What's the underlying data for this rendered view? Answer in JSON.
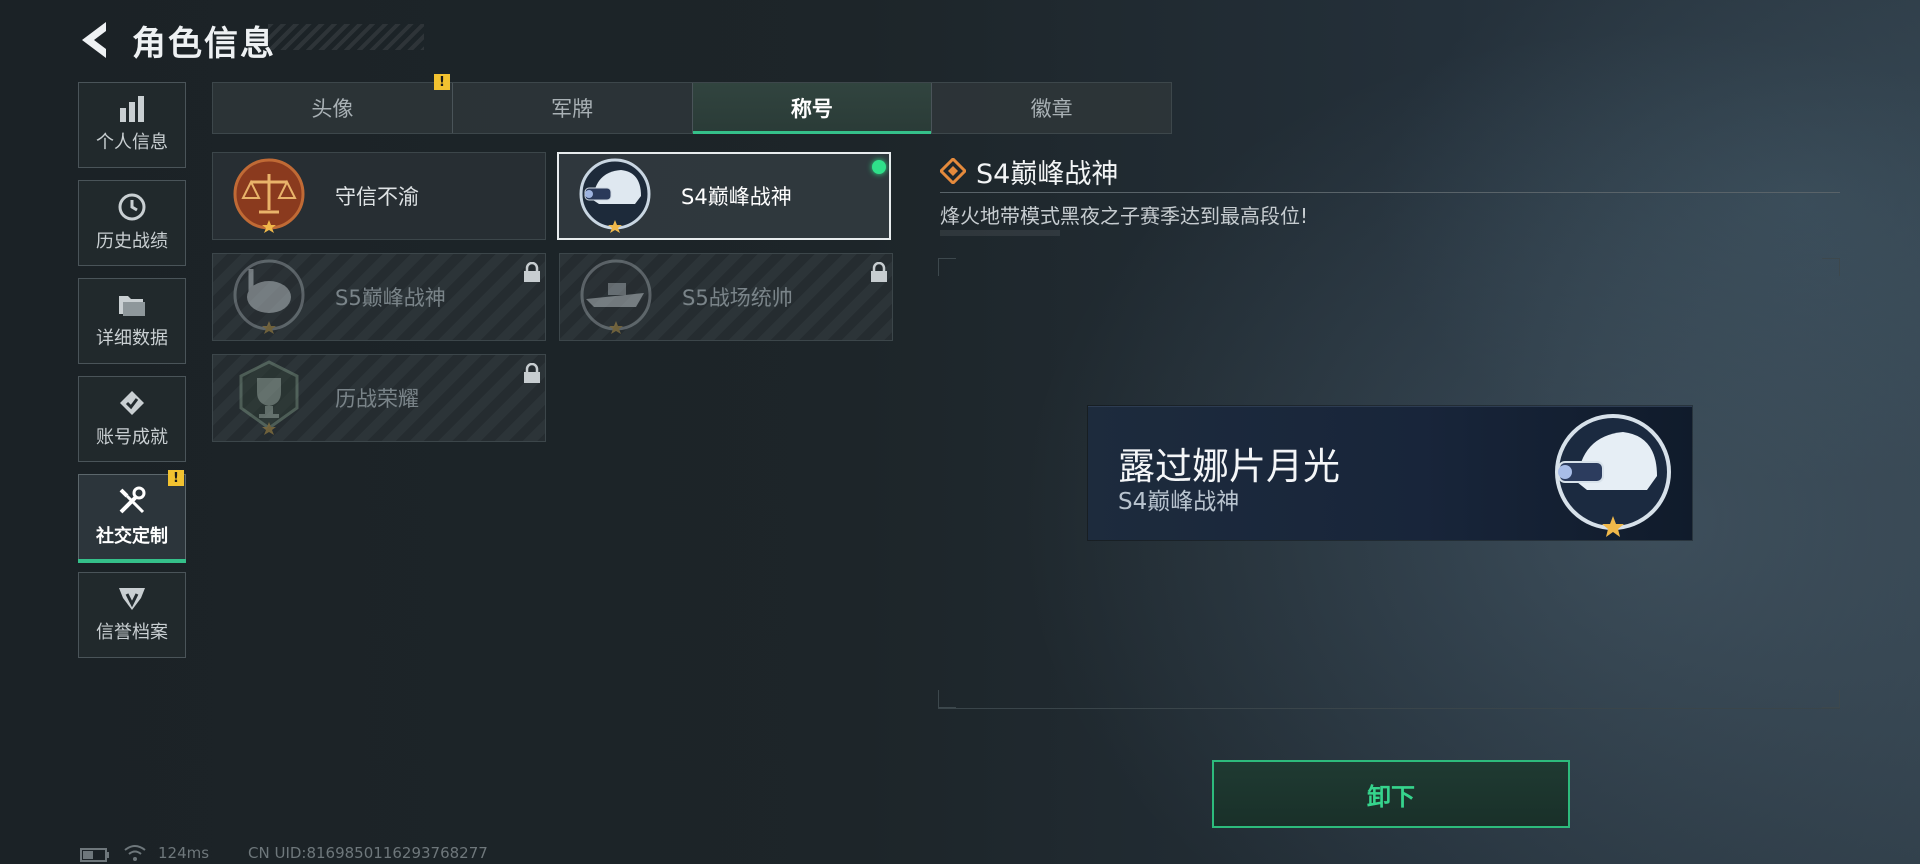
{
  "header": {
    "title": "角色信息"
  },
  "sidebar": {
    "items": [
      {
        "label": "个人信息",
        "icon": "bar-chart-icon"
      },
      {
        "label": "历史战绩",
        "icon": "clock-icon"
      },
      {
        "label": "详细数据",
        "icon": "folder-icon"
      },
      {
        "label": "账号成就",
        "icon": "achievement-icon"
      },
      {
        "label": "社交定制",
        "icon": "tools-icon",
        "active": true,
        "alert": "!"
      },
      {
        "label": "信誉档案",
        "icon": "reputation-icon"
      }
    ]
  },
  "tabs": [
    {
      "label": "头像",
      "alert": "!"
    },
    {
      "label": "军牌"
    },
    {
      "label": "称号",
      "active": true
    },
    {
      "label": "徽章"
    }
  ],
  "cards": [
    {
      "name": "守信不渝",
      "locked": false
    },
    {
      "name": "S4巅峰战神",
      "locked": false,
      "selected": true,
      "equipped": true
    },
    {
      "name": "S5巅峰战神",
      "locked": true
    },
    {
      "name": "S5战场统帅",
      "locked": true
    },
    {
      "name": "历战荣耀",
      "locked": true
    }
  ],
  "detail": {
    "title": "S4巅峰战神",
    "description": "烽火地带模式黑夜之子赛季达到最高段位!"
  },
  "preview": {
    "nickname": "露过娜片月光",
    "title": "S4巅峰战神"
  },
  "action": {
    "label": "卸下"
  },
  "status": {
    "ping": "124ms",
    "uid": "CN UID:8169850116293768277"
  },
  "colors": {
    "accent": "#35c08a",
    "alert": "#f2c230",
    "equipped": "#2fe08a"
  }
}
